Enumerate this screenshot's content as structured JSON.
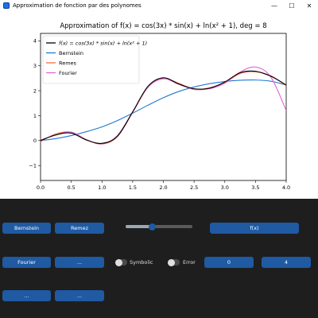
{
  "window": {
    "title": "Approximation de fonction par des polynomes",
    "minimize_glyph": "—",
    "maximize_glyph": "☐",
    "close_glyph": "✕"
  },
  "chart_data": {
    "type": "line",
    "title": "Approximation of f(x) = cos(3x) * sin(x) + ln(x² + 1), deg = 8",
    "xlabel": "",
    "ylabel": "",
    "xlim": [
      0.0,
      4.0
    ],
    "ylim": [
      -1.6,
      4.3
    ],
    "x_ticks": [
      "0.0",
      "0.5",
      "1.0",
      "1.5",
      "2.0",
      "2.5",
      "3.0",
      "3.5",
      "4.0"
    ],
    "y_ticks": [
      "−1",
      "0",
      "1",
      "2",
      "3",
      "4"
    ],
    "grid": false,
    "legend_position": "top-left",
    "series": [
      {
        "name": "f(x) = cos(3x) * sin(x) + ln(x² + 1)",
        "color": "#000000",
        "x": [
          0,
          0.25,
          0.5,
          0.75,
          1.0,
          1.25,
          1.5,
          1.75,
          2.0,
          2.25,
          2.5,
          2.75,
          3.0,
          3.25,
          3.5,
          3.75,
          4.0
        ],
        "y": [
          0,
          0.23,
          0.3,
          0.02,
          -0.11,
          0.17,
          1.15,
          2.18,
          2.52,
          2.27,
          2.08,
          2.1,
          2.35,
          2.72,
          2.78,
          2.58,
          2.23
        ]
      },
      {
        "name": "Bernstein",
        "color": "#1f77d4",
        "x": [
          0,
          0.25,
          0.5,
          0.75,
          1.0,
          1.25,
          1.5,
          1.75,
          2.0,
          2.25,
          2.5,
          2.75,
          3.0,
          3.25,
          3.5,
          3.75,
          4.0
        ],
        "y": [
          0,
          0.08,
          0.2,
          0.36,
          0.55,
          0.8,
          1.1,
          1.42,
          1.72,
          1.97,
          2.15,
          2.28,
          2.37,
          2.42,
          2.43,
          2.38,
          2.23
        ]
      },
      {
        "name": "Remes",
        "color": "#ff6a3d",
        "x": [
          0,
          0.25,
          0.5,
          0.75,
          1.0,
          1.25,
          1.5,
          1.75,
          2.0,
          2.25,
          2.5,
          2.75,
          3.0,
          3.25,
          3.5,
          3.75,
          4.0
        ],
        "y": [
          -0.04,
          0.27,
          0.34,
          0.04,
          -0.14,
          0.16,
          1.13,
          2.14,
          2.48,
          2.3,
          2.05,
          2.12,
          2.32,
          2.69,
          2.76,
          2.6,
          2.2
        ]
      },
      {
        "name": "Fourier",
        "color": "#e067d9",
        "x": [
          0,
          0.25,
          0.5,
          0.75,
          1.0,
          1.25,
          1.5,
          1.75,
          2.0,
          2.25,
          2.5,
          2.75,
          3.0,
          3.25,
          3.5,
          3.75,
          4.0
        ],
        "y": [
          0.02,
          0.22,
          0.34,
          0.03,
          -0.13,
          0.2,
          1.15,
          2.15,
          2.48,
          2.26,
          2.06,
          2.08,
          2.3,
          2.75,
          2.95,
          2.55,
          1.2
        ]
      }
    ]
  },
  "controls": {
    "bernstein_label": "Bernstein",
    "remez_label": "Remez",
    "fx_label": "f(x)",
    "fourier_label": "Fourier",
    "ellipsis_1_label": "...",
    "ellipsis_2_label": "...",
    "ellipsis_3_label": "...",
    "symbolic_label": "Symbolic",
    "error_label": "Error",
    "range_start": "0",
    "range_end": "4",
    "degree_slider_fraction": 0.4,
    "symbolic_on": false,
    "error_on": false
  },
  "colors": {
    "button": "#1f5aa3",
    "panel_bg": "#1e1e1e",
    "plot_bg": "#ffffff"
  }
}
